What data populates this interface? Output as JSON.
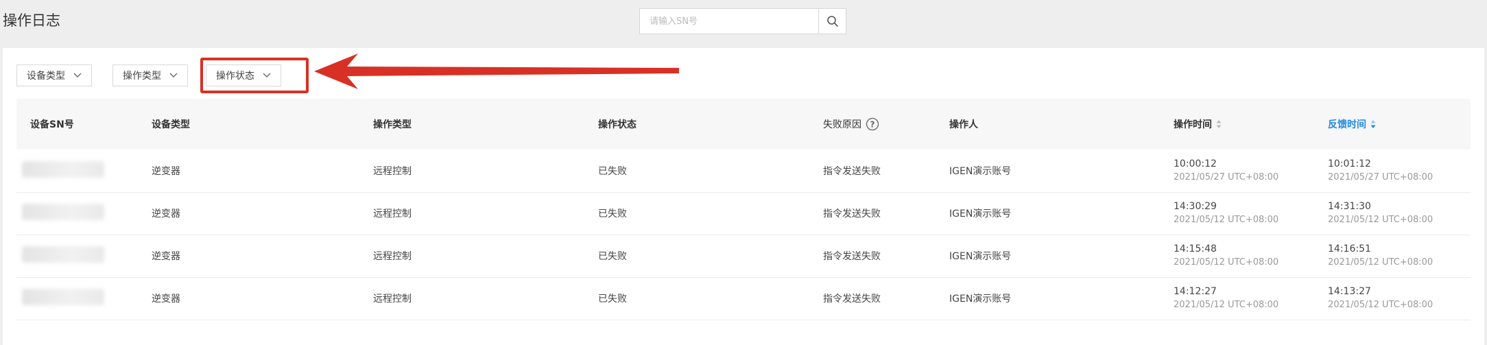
{
  "page": {
    "title": "操作日志"
  },
  "search": {
    "placeholder": "请输入SN号"
  },
  "filters": [
    {
      "label": "设备类型"
    },
    {
      "label": "操作类型"
    },
    {
      "label": "操作状态"
    }
  ],
  "table": {
    "columns": [
      "设备SN号",
      "设备类型",
      "操作类型",
      "操作状态",
      "失败原因",
      "操作人",
      "操作时间",
      "反馈时间"
    ],
    "rows": [
      {
        "device_type": "逆变器",
        "op_type": "远程控制",
        "status": "已失败",
        "reason": "指令发送失败",
        "operator": "IGEN演示账号",
        "op_time": "10:00:12",
        "op_date": "2021/05/27 UTC+08:00",
        "fb_time": "10:01:12",
        "fb_date": "2021/05/27 UTC+08:00"
      },
      {
        "device_type": "逆变器",
        "op_type": "远程控制",
        "status": "已失败",
        "reason": "指令发送失败",
        "operator": "IGEN演示账号",
        "op_time": "14:30:29",
        "op_date": "2021/05/12 UTC+08:00",
        "fb_time": "14:31:30",
        "fb_date": "2021/05/12 UTC+08:00"
      },
      {
        "device_type": "逆变器",
        "op_type": "远程控制",
        "status": "已失败",
        "reason": "指令发送失败",
        "operator": "IGEN演示账号",
        "op_time": "14:15:48",
        "op_date": "2021/05/12 UTC+08:00",
        "fb_time": "14:16:51",
        "fb_date": "2021/05/12 UTC+08:00"
      },
      {
        "device_type": "逆变器",
        "op_type": "远程控制",
        "status": "已失败",
        "reason": "指令发送失败",
        "operator": "IGEN演示账号",
        "op_time": "14:12:27",
        "op_date": "2021/05/12 UTC+08:00",
        "fb_time": "14:13:27",
        "fb_date": "2021/05/12 UTC+08:00"
      }
    ]
  },
  "colors": {
    "accent": "#1e88e5",
    "annotation": "#d93025"
  }
}
